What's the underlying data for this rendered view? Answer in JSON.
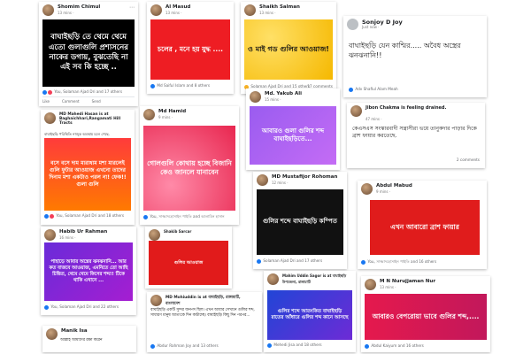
{
  "cards": {
    "c1": {
      "name": "Shomim Chimul",
      "time": "13 mins · ",
      "post": "বাঘাইছড়ি তে থেমে থেমে এতো গুলাগুলি প্রশাসনের নাকের ডগায়, বুঝতেছি না এই সব কি হচ্ছে ..",
      "reactions": "You, Solaman Ajad Dri and 17 others",
      "actions": [
        "Like",
        "Comment",
        "Send"
      ]
    },
    "c2": {
      "name": "Al Masud",
      "time": "13 mins · ",
      "post": "চলের , মনে হয় যুদ্ধ ....",
      "reactions": "Md Saiful Islam and 8 others"
    },
    "c3": {
      "name": "Shaikh Salman",
      "time": "13 mins · ",
      "post": "ও মাই গড গুলির আওয়াজ!",
      "reactions": "Solaman Ajad Dri and 15 others",
      "comments": "17 comments"
    },
    "c4": {
      "name": "Sonjoy D Joy",
      "time": "Just now · ",
      "post": "বাঘাইছড়ি যেন কাশ্মির..... অবৈধ অস্ত্রের ঝনঝনানি!!",
      "reactions": "Adv Shafiul Alam Meah"
    },
    "c5": {
      "name": "MD Mahedi Hasan",
      "title": "MD Mahedi Hasan is at Baghaichhari,Rangamati Hill Tracts",
      "time": "16 mins · ",
      "caption": "বাঘাইছড়ি পরিস্থিতি নাজুক অবস্থায় চলে গেছে.",
      "post": "বসে বসে দাম মারাধ্যম মশা মারলেই গুলি ফুটার আওয়াজ এখনো তাদের দিনাম মশা একটাও পরল না! ফেক!! গুলা গুলি",
      "reactions": "You, Solaman Ajad Dri and 18 others",
      "actions": [
        "Like",
        "Comment"
      ]
    },
    "c6": {
      "name": "Md Hamid",
      "time": "9 mins · ",
      "post": "গোলগুলি কোথায় হচ্ছে বিজানি কেও জানলে যানাবেন",
      "reactions": "You, সাজ্জাদহোসাইন পাইতি and আলামিন হাসান"
    },
    "c7": {
      "name": "Md. Yakub Ali",
      "time": "15 mins · ",
      "post": "আবারও গুলা গুলির শব্দ বাঘাইছড়িতে..."
    },
    "c8": {
      "name": "Jibon Chakma",
      "title": "Jibon Chakma is feeling drained.",
      "time": "47 mins · ",
      "text": "কেএসএস সংস্কারবাদী সন্ত্রাসীরা ভয়ে তানুকদার পাড়ার দিকে ব্রাশ ফায়ার করতেছে.",
      "comments": "2 comments"
    },
    "c9": {
      "name": "Habib Ur Rahman",
      "time": "16 mins · ",
      "post": "পাহাড়ে আবার অস্ত্রের ঝনঝনানি... আর কত বাজবে আওয়াজ, এমনিতে তো আছি চিন্তিত, থেমে থেমে কিসের শব্দ!! টিকে থাকি এখানে ...",
      "reactions": "You, Solaman Ajad Dri and 22 others"
    },
    "c10": {
      "name": "Shakib Sarcar",
      "time": "",
      "post": "গুলির আওয়াজ",
      "reactions": "Solaman Ajad Dri and 17 others"
    },
    "c11": {
      "name": "MD Mustafijor Rohoman",
      "time": "12 mins · ",
      "post": "গুলির শব্দে বাঘাইছড়ি কম্পিত",
      "reactions": "Solaman Ajad Dri and 17 others"
    },
    "c12": {
      "name": "Abdul Mabud",
      "time": "9 mins · ",
      "post": "এখন আবারো ব্রাশ ফায়ার",
      "reactions": "You, সাজ্জাদহোসাইন পাইতি and 16 others"
    },
    "c13": {
      "name": "MD Mohiuddin",
      "title": "MD Mohiuddin is at বাঘাইছড়ি, রাঙ্গামাটি, বাংলাদেশ",
      "time": "25 mins · ",
      "text": "বাঘাইছড়ি একটি সুন্দর জনপদ ছিল। এখন আবার সেখানে গুলির শব্দ, সাধারণ মানুষ আতংকে দিন কাটাচ্ছে। বাঘাইছড়ি কিছু দিন পরপর...",
      "reactions": "Abdur Rahman Joy and 13 others"
    },
    "c14": {
      "name": "Mahim Uddin Sagor",
      "title": "Mahim Uddin Sagor is at বাঘাইছড়ি উপজেলা, রাঙ্গামাটি",
      "time": "19 mins · ",
      "post": "গুলির শব্দে আতংকিত বাঘাইছড়ি রাতের আঁধারে গুলির শব্দ কানে আসছে",
      "reactions": "Mehedi Jisa and 18 others"
    },
    "c15": {
      "name": "M N Nurujjaman Nur",
      "time": "13 mins · ",
      "post": "আবারও বেপরোয়া ভাবে গুলির শব্দ,....",
      "reactions": "Abdul Kaiyum and 16 others"
    },
    "c16": {
      "name": "Manik Isa",
      "time": "",
      "text": "আল্লাহ আমাদের রক্ষা করেন"
    }
  }
}
